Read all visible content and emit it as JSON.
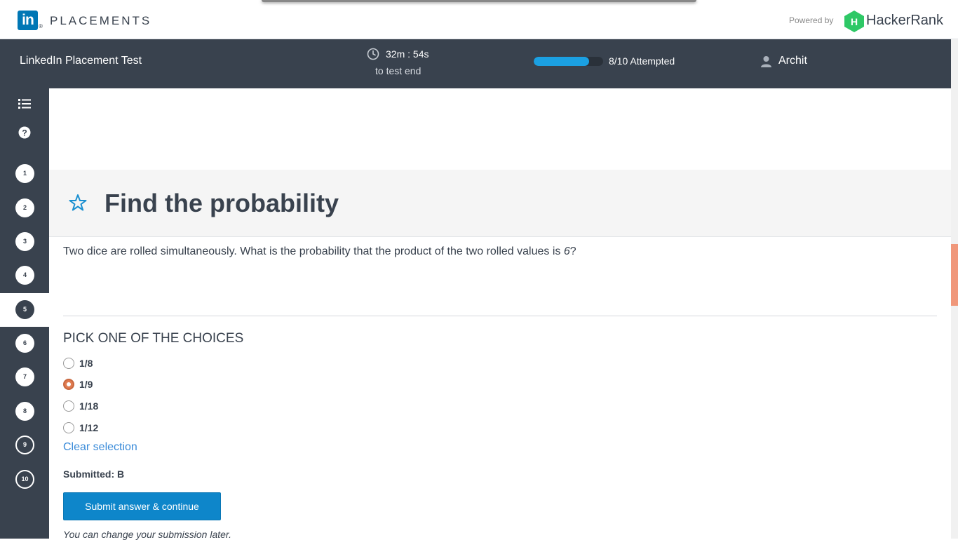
{
  "brand": {
    "logo_text": "in",
    "logo_mark": "®",
    "product": "PLACEMENTS",
    "powered_by": "Powered by",
    "partner": "HackerRank",
    "colors": {
      "linkedin_blue": "#0077b5",
      "hackerrank_green": "#2ec866"
    }
  },
  "header": {
    "test_title": "LinkedIn Placement Test",
    "timer": "32m : 54s",
    "timer_sub": "to test end",
    "progress": {
      "attempted": 8,
      "total": 10,
      "label": "8/10 Attempted"
    },
    "user_name": "Archit"
  },
  "sidebar": {
    "icons": [
      "list-icon",
      "help-icon"
    ],
    "questions": [
      {
        "label": "1",
        "state": "attempted"
      },
      {
        "label": "2",
        "state": "attempted"
      },
      {
        "label": "3",
        "state": "attempted"
      },
      {
        "label": "4",
        "state": "attempted"
      },
      {
        "label": "5",
        "state": "current"
      },
      {
        "label": "6",
        "state": "attempted"
      },
      {
        "label": "7",
        "state": "attempted"
      },
      {
        "label": "8",
        "state": "attempted"
      },
      {
        "label": "9",
        "state": "unattempted"
      },
      {
        "label": "10",
        "state": "unattempted"
      }
    ]
  },
  "question": {
    "title": "Find the probability",
    "text_before": "Two dice are rolled simultaneously. What is the probability that the product of the two rolled values is ",
    "text_em": "6",
    "text_after": "?",
    "pick_label": "PICK ONE OF THE CHOICES",
    "choices": [
      {
        "label": "1/8",
        "selected": false
      },
      {
        "label": "1/9",
        "selected": true
      },
      {
        "label": "1/18",
        "selected": false
      },
      {
        "label": "1/12",
        "selected": false
      }
    ],
    "clear_label": "Clear selection",
    "submitted_label": "Submitted: B",
    "submit_button": "Submit answer & continue",
    "note": "You can change your submission later."
  },
  "accent_colors": {
    "header_bg": "#39424e",
    "button_blue": "#0e86ca",
    "radio_selected": "#e07b50",
    "link": "#3a8bd9"
  }
}
